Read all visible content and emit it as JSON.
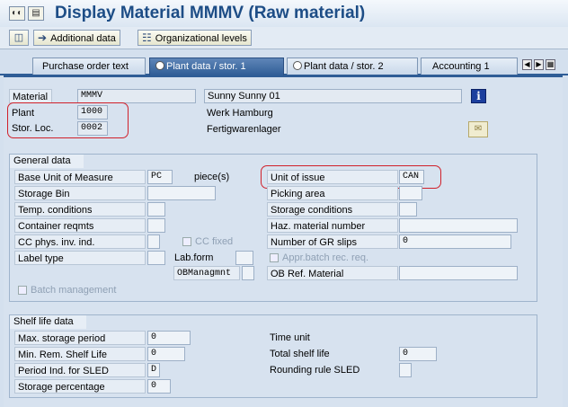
{
  "header": {
    "title": "Display Material MMMV (Raw material)"
  },
  "toolbar": {
    "additional_data": "Additional data",
    "org_levels": "Organizational levels"
  },
  "tabs": [
    {
      "label": "Purchase order text"
    },
    {
      "label": "Plant data / stor. 1"
    },
    {
      "label": "Plant data / stor. 2"
    },
    {
      "label": "Accounting 1"
    }
  ],
  "header_fields": {
    "material_label": "Material",
    "material_value": "MMMV",
    "material_desc": "Sunny Sunny 01",
    "plant_label": "Plant",
    "plant_value": "1000",
    "plant_name": "Werk Hamburg",
    "storloc_label": "Stor. Loc.",
    "storloc_value": "0002",
    "storloc_name": "Fertigwarenlager"
  },
  "general": {
    "title": "General data",
    "base_uom_label": "Base Unit of Measure",
    "base_uom_value": "PC",
    "base_uom_text": "piece(s)",
    "unit_issue_label": "Unit of issue",
    "unit_issue_value": "CAN",
    "storage_bin_label": "Storage Bin",
    "picking_area_label": "Picking area",
    "temp_cond_label": "Temp. conditions",
    "storage_cond_label": "Storage conditions",
    "container_label": "Container reqmts",
    "haz_label": "Haz. material number",
    "cc_phys_label": "CC phys. inv. ind.",
    "cc_fixed_label": "CC fixed",
    "gr_slips_label": "Number of GR slips",
    "gr_slips_value": "0",
    "label_type_label": "Label type",
    "lab_form_label": "Lab.form",
    "appr_batch_label": "Appr.batch rec. req.",
    "ob_managmnt_label": "OBManagmnt",
    "ob_ref_label": "OB Ref. Material",
    "batch_mgmt_label": "Batch management"
  },
  "shelf": {
    "title": "Shelf life data",
    "max_storage_label": "Max. storage period",
    "max_storage_value": "0",
    "time_unit_label": "Time unit",
    "min_rem_label": "Min. Rem. Shelf Life",
    "min_rem_value": "0",
    "total_shelf_label": "Total shelf life",
    "total_shelf_value": "0",
    "period_ind_label": "Period Ind. for SLED",
    "period_ind_value": "D",
    "rounding_label": "Rounding rule SLED",
    "storage_pct_label": "Storage percentage",
    "storage_pct_value": "0"
  },
  "colors": {
    "title": "#1d4d86",
    "highlight": "#d0202a",
    "active_tab": "#2f5d96"
  }
}
